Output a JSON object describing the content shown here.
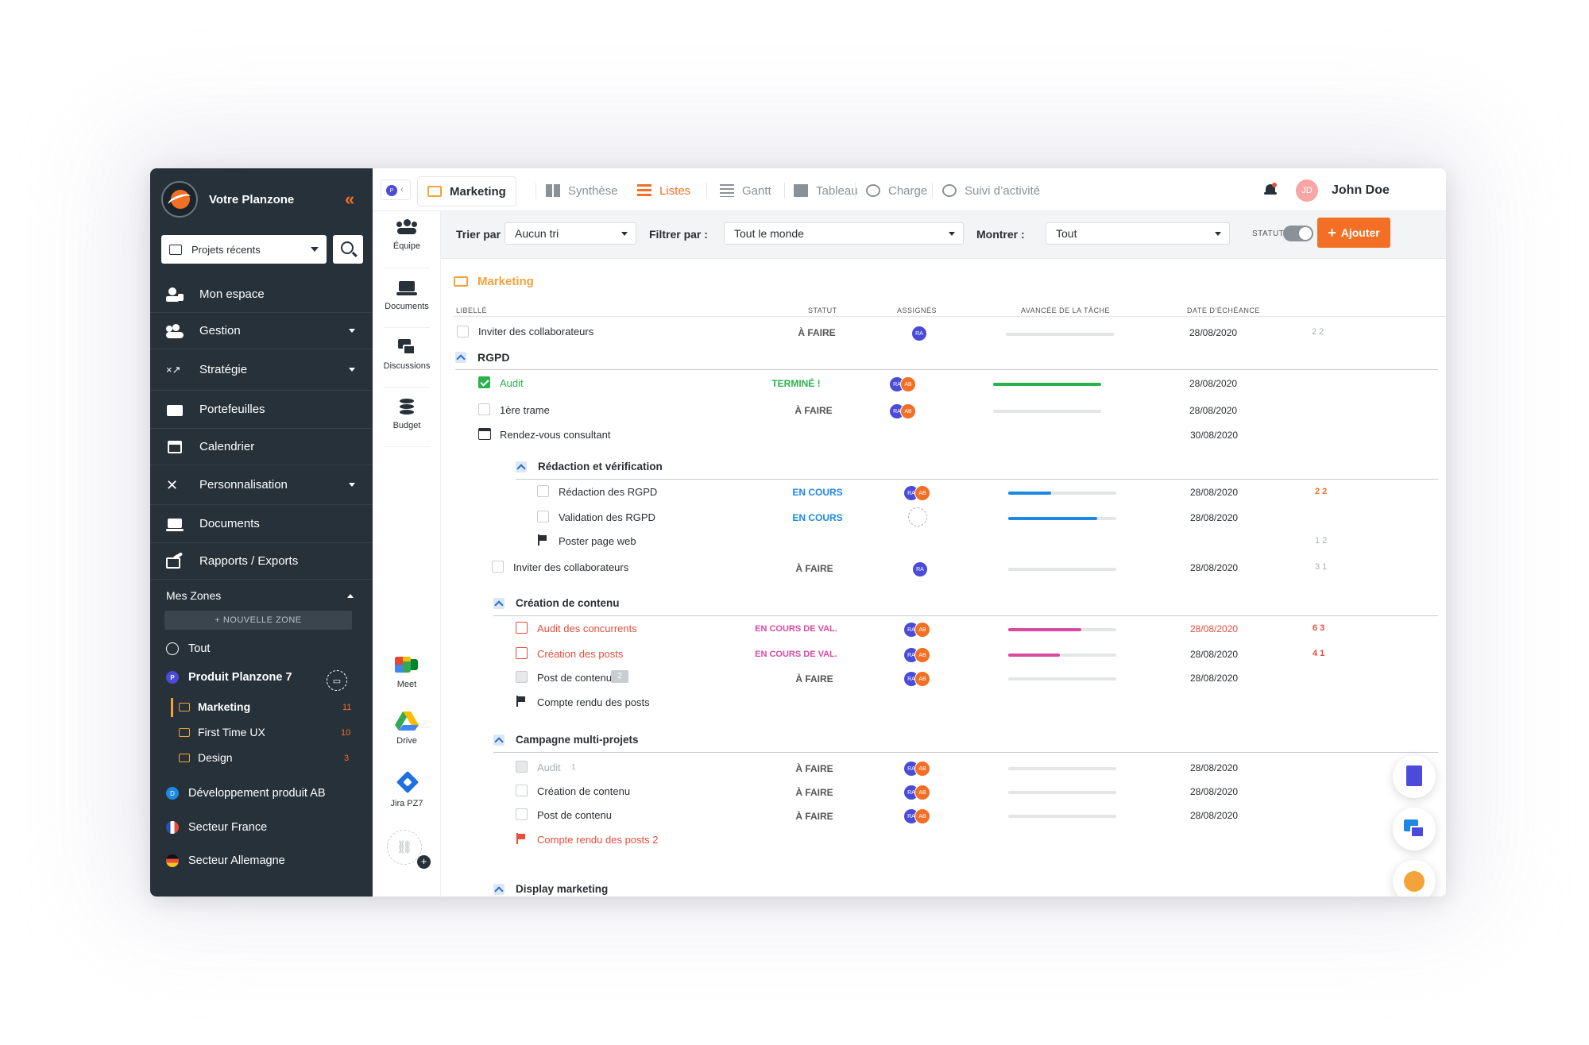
{
  "brand": {
    "name": "Votre Planzone"
  },
  "sidebar": {
    "project_select": "Projets récents",
    "nav": [
      {
        "label": "Mon espace",
        "icon": "user-lock-icon",
        "dropdown": false
      },
      {
        "label": "Gestion",
        "icon": "users-gear-icon",
        "dropdown": true
      },
      {
        "label": "Stratégie",
        "icon": "strategy-icon",
        "dropdown": true
      },
      {
        "label": "Portefeuilles",
        "icon": "wallet-icon",
        "dropdown": false
      },
      {
        "label": "Calendrier",
        "icon": "calendar-icon",
        "dropdown": false
      },
      {
        "label": "Personnalisation",
        "icon": "tools-icon",
        "dropdown": true
      },
      {
        "label": "Documents",
        "icon": "laptop-icon",
        "dropdown": false
      },
      {
        "label": "Rapports / Exports",
        "icon": "share-icon",
        "dropdown": false
      }
    ],
    "zones_title": "Mes Zones",
    "new_zone": "+ NOUVELLE ZONE",
    "all": "Tout",
    "product": "Produit Planzone 7",
    "product_badge": "P",
    "subzones": [
      {
        "label": "Marketing",
        "count": "11"
      },
      {
        "label": "First Time UX",
        "count": "10"
      },
      {
        "label": "Design",
        "count": "3"
      }
    ],
    "dev": "Développement produit AB",
    "dev_badge": "D",
    "france": "Secteur France",
    "allemagne": "Secteur Allemagne"
  },
  "iconcol": {
    "team": "Équipe",
    "documents": "Documents",
    "discussions": "Discussions",
    "budget": "Budget",
    "meet": "Meet",
    "drive": "Drive",
    "jira": "Jira PZ7"
  },
  "topbar": {
    "tabs": [
      "Marketing",
      "Synthèse",
      "Listes",
      "Gantt",
      "Tableau",
      "Charge",
      "Suivi d’activité"
    ],
    "user": "John Doe",
    "initials": "JD",
    "project_badge": "P"
  },
  "filters": {
    "sort_label": "Trier par :",
    "sort_value": "Aucun tri",
    "filter_label": "Filtrer par :",
    "filter_value": "Tout le monde",
    "show_label": "Montrer :",
    "show_value": "Tout",
    "statut": "STATUT",
    "add": "Ajouter"
  },
  "list": {
    "title": "Marketing",
    "headers": {
      "libelle": "LIBELLÉ",
      "statut": "STATUT",
      "assignes": "ASSIGNÉS",
      "avancement": "AVANCÉE DE LA TÂCHE",
      "echeance": "DATE D’ÉCHÉANCE"
    },
    "r1": {
      "label": "Inviter des collaborateurs",
      "status": "À FAIRE",
      "date": "28/08/2020",
      "meta": "2 2"
    },
    "g1": "RGPD",
    "r2": {
      "label": "Audit",
      "status": "TERMINÉ !",
      "date": "28/08/2020",
      "progress": 1.0
    },
    "r3": {
      "label": "1ère trame",
      "status": "À FAIRE",
      "date": "28/08/2020"
    },
    "r4": {
      "label": "Rendez-vous consultant",
      "date": "30/08/2020"
    },
    "g2": "Rédaction et vérification",
    "r5": {
      "label": "Rédaction des RGPD",
      "status": "EN COURS",
      "date": "28/08/2020",
      "meta": "2 2",
      "progress": 0.4
    },
    "r6": {
      "label": "Validation des RGPD",
      "status": "EN COURS",
      "date": "28/08/2020",
      "progress": 0.82
    },
    "r7": {
      "label": "Poster page web",
      "meta": "1 2"
    },
    "r8": {
      "label": "Inviter des collaborateurs",
      "status": "À FAIRE",
      "date": "28/08/2020",
      "meta": "3 1"
    },
    "g3": "Création de contenu",
    "r9": {
      "label": "Audit des concurrents",
      "status": "EN COURS DE VAL.",
      "date": "28/08/2020",
      "meta": "6 3",
      "progress": 0.68
    },
    "r10": {
      "label": "Création des posts",
      "status": "EN COURS DE VAL.",
      "date": "28/08/2020",
      "meta": "4 1",
      "progress": 0.48
    },
    "r11": {
      "label": "Post de contenu",
      "status": "À FAIRE",
      "date": "28/08/2020",
      "badge": "2"
    },
    "r12": {
      "label": "Compte rendu des posts"
    },
    "g4": "Campagne multi-projets",
    "r13": {
      "label": "Audit",
      "status": "À FAIRE",
      "date": "28/08/2020",
      "count": "1"
    },
    "r14": {
      "label": "Création de contenu",
      "status": "À FAIRE",
      "date": "28/08/2020"
    },
    "r15": {
      "label": "Post de contenu",
      "status": "À FAIRE",
      "date": "28/08/2020"
    },
    "r16": {
      "label": "Compte rendu des posts 2"
    },
    "g5": "Display marketing",
    "assignees": {
      "ra": "RA",
      "ab": "AB"
    }
  },
  "colors": {
    "accent": "#f36f25",
    "sidebar": "#26313a",
    "done": "#2bb24c",
    "progress": "#1e88e5",
    "validation": "#d94aa0"
  }
}
